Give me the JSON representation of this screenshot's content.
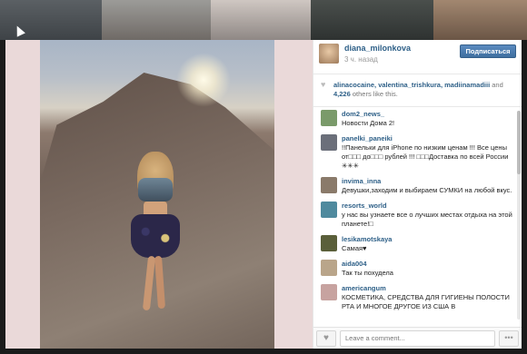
{
  "colors": {
    "accent": "#2d5f87",
    "follow_button": "#4a7db1",
    "photo_bg": "#ead9d9"
  },
  "post": {
    "username": "diana_milonkova",
    "time": "3 ч. назад",
    "follow_label": "Подписаться"
  },
  "likes": {
    "names": "alinacocaine, valentina_trishkura, madiinamadiii",
    "and": "and",
    "count": "4,226",
    "rest": "others like this."
  },
  "comments": [
    {
      "user": "dom2_news_",
      "text": "Новости Дома 2!",
      "avatar_color": "#7a9a6a"
    },
    {
      "user": "panelki_paneiki",
      "text": "!!Панельки для iPhone по низким ценам !!! Все цены от□□□ до□□□ рублей !!! □□□Доставка по всей России ✳✳✳",
      "avatar_color": "#6b6f7a"
    },
    {
      "user": "invima_inna",
      "text": "Девушки,заходим и выбираем СУМКИ на любой вкус.",
      "avatar_color": "#8a7a6a"
    },
    {
      "user": "resorts_world",
      "text": "у нас вы узнаете все о лучших местах отдыха на этой планете!□",
      "avatar_color": "#4f8a9e"
    },
    {
      "user": "lesikamotskaya",
      "text": "Самая♥",
      "avatar_color": "#5a5f3a"
    },
    {
      "user": "aida004",
      "text": "Так ты похудела",
      "avatar_color": "#b9a58a"
    },
    {
      "user": "americangum",
      "text": "КОСМЕТИКА, СРЕДСТВА ДЛЯ ГИГИЕНЫ ПОЛОСТИ РТА И МНОГОЕ ДРУГОЕ ИЗ США В",
      "avatar_color": "#c7a3a0"
    }
  ],
  "footer": {
    "comment_placeholder": "Leave a comment...",
    "more_label": "•••"
  },
  "icons": {
    "heart": "heart-icon",
    "more": "ellipsis-icon"
  }
}
